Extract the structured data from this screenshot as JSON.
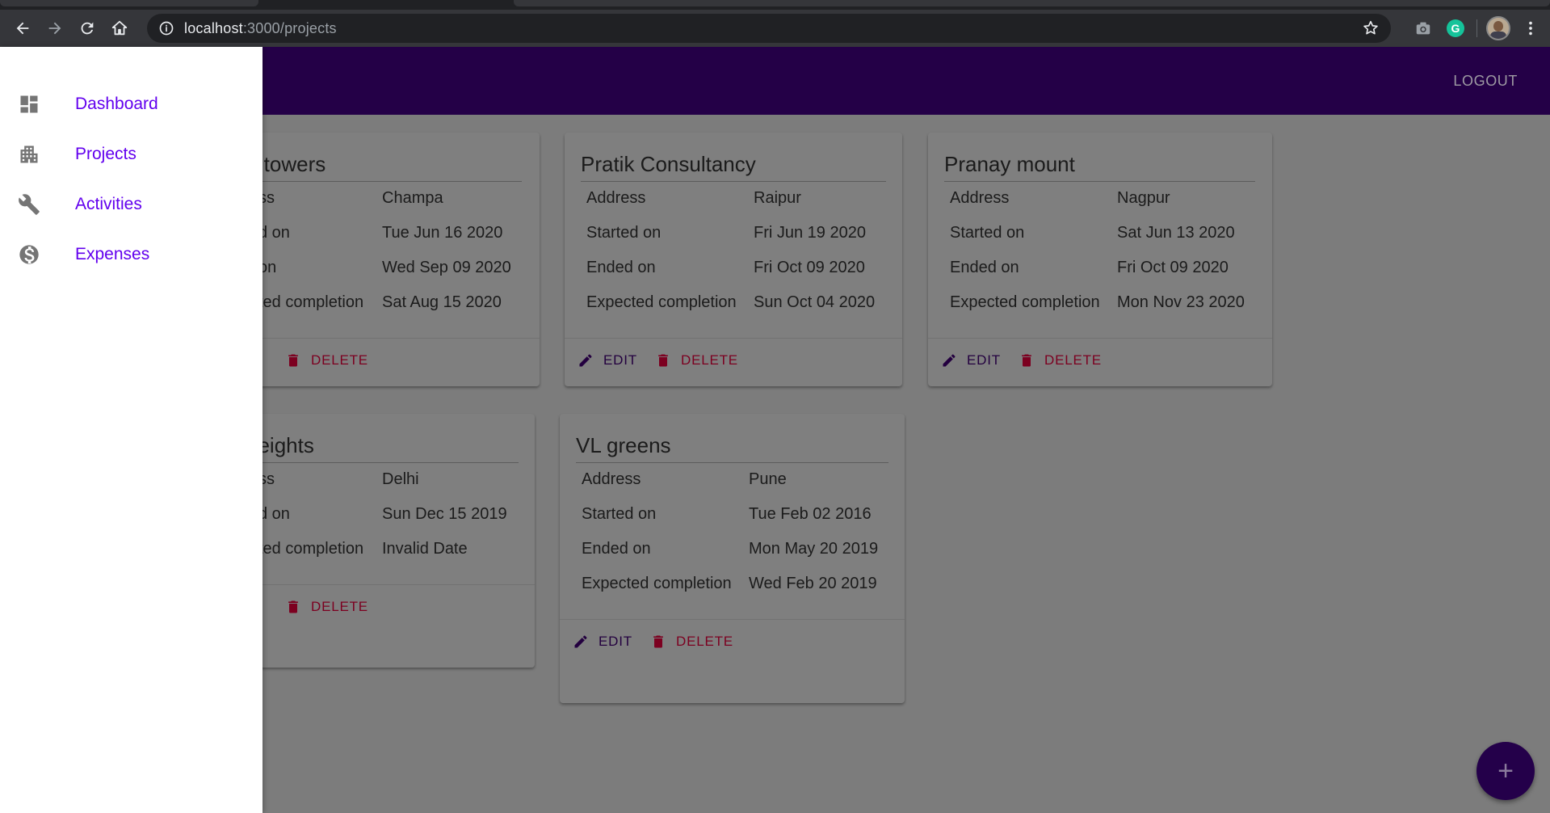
{
  "browser": {
    "url_host": "localhost",
    "url_path": ":3000/projects"
  },
  "app": {
    "logout_label": "LOGOUT",
    "fab_symbol": "+"
  },
  "drawer": {
    "items": [
      {
        "label": "Dashboard",
        "icon": "dashboard-icon"
      },
      {
        "label": "Projects",
        "icon": "apartment-icon"
      },
      {
        "label": "Activities",
        "icon": "wrench-icon"
      },
      {
        "label": "Expenses",
        "icon": "dollar-icon"
      }
    ]
  },
  "actions": {
    "edit": "EDIT",
    "delete": "DELETE"
  },
  "projects": [
    {
      "title": "a towers",
      "rows": [
        {
          "label": "ss",
          "value": "Champa"
        },
        {
          "label": "d on",
          "value": "Tue Jun 16 2020"
        },
        {
          "label": "on",
          "value": "Wed Sep 09 2020"
        },
        {
          "label": "ted completion",
          "value": "Sat Aug 15 2020"
        }
      ]
    },
    {
      "title": "Pratik Consultancy",
      "rows": [
        {
          "label": "Address",
          "value": "Raipur"
        },
        {
          "label": "Started on",
          "value": "Fri Jun 19 2020"
        },
        {
          "label": "Ended on",
          "value": "Fri Oct 09 2020"
        },
        {
          "label": "Expected completion",
          "value": "Sun Oct 04 2020"
        }
      ]
    },
    {
      "title": "Pranay mount",
      "rows": [
        {
          "label": "Address",
          "value": "Nagpur"
        },
        {
          "label": "Started on",
          "value": "Sat Jun 13 2020"
        },
        {
          "label": "Ended on",
          "value": "Fri Oct 09 2020"
        },
        {
          "label": "Expected completion",
          "value": "Mon Nov 23 2020"
        }
      ]
    },
    {
      "title": "heights",
      "rows": [
        {
          "label": "ss",
          "value": "Delhi"
        },
        {
          "label": "d on",
          "value": "Sun Dec 15 2019"
        },
        {
          "label": "ted completion",
          "value": "Invalid Date"
        }
      ]
    },
    {
      "title": "VL greens",
      "rows": [
        {
          "label": "Address",
          "value": "Pune"
        },
        {
          "label": "Started on",
          "value": "Tue Feb 02 2016"
        },
        {
          "label": "Ended on",
          "value": "Mon May 20 2019"
        },
        {
          "label": "Expected completion",
          "value": "Wed Feb 20 2019"
        }
      ]
    }
  ],
  "colors": {
    "appbar": "#240047",
    "drawer_link": "#6200ee",
    "edit": "#23003f",
    "delete": "#7c0020"
  }
}
